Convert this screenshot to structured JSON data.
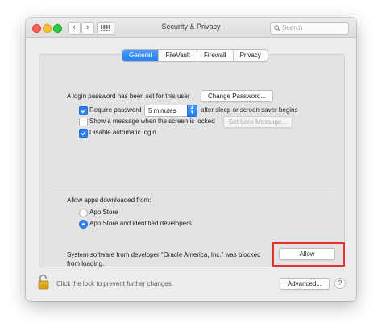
{
  "window": {
    "title": "Security & Privacy",
    "search": {
      "placeholder": "Search"
    }
  },
  "tabs": [
    {
      "label": "General",
      "active": true
    },
    {
      "label": "FileVault",
      "active": false
    },
    {
      "label": "Firewall",
      "active": false
    },
    {
      "label": "Privacy",
      "active": false
    }
  ],
  "general": {
    "login_password_text": "A login password has been set for this user",
    "change_password_button": "Change Password...",
    "require_password": {
      "label": "Require password",
      "checked": true,
      "value": "5 minutes",
      "suffix": "after sleep or screen saver begins"
    },
    "show_message": {
      "label": "Show a message when the screen is locked",
      "checked": false
    },
    "set_lock_message_button": "Set Lock Message...",
    "disable_auto_login": {
      "label": "Disable automatic login",
      "checked": true
    }
  },
  "allow_apps": {
    "heading": "Allow apps downloaded from:",
    "options": [
      {
        "label": "App Store",
        "selected": false
      },
      {
        "label": "App Store and identified developers",
        "selected": true
      }
    ]
  },
  "blocked": {
    "line1": "System software from developer “Oracle America, Inc.” was blocked",
    "line2": "from loading.",
    "allow_button": "Allow",
    "highlight_color": "#e8322d"
  },
  "footer": {
    "lock_text": "Click the lock to prevent further changes.",
    "advanced_button": "Advanced...",
    "help_button": "?"
  },
  "colors": {
    "accent": "#2a84f2"
  }
}
